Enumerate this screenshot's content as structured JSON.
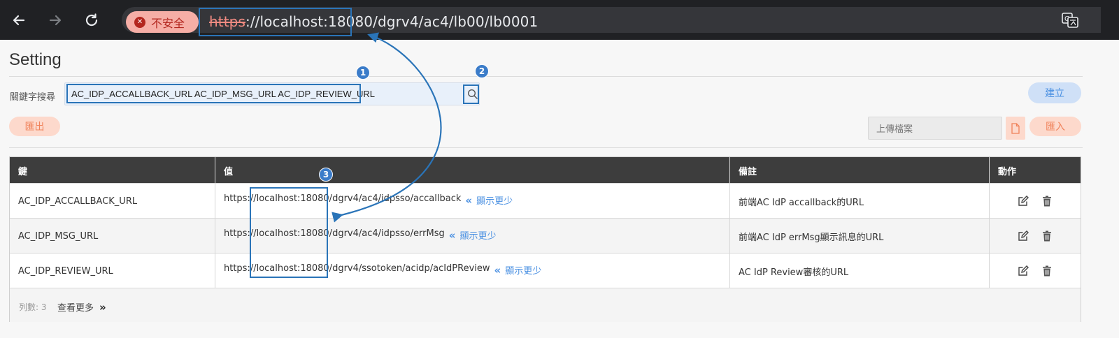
{
  "browser": {
    "insecure_label": "不安全",
    "url_protocol": "https",
    "url_rest": "://localhost:18080/dgrv4/ac4/lb00/lb0001"
  },
  "page": {
    "title": "Setting"
  },
  "search": {
    "label": "關鍵字搜尋",
    "value": "AC_IDP_ACCALLBACK_URL AC_IDP_MSG_URL AC_IDP_REVIEW_URL"
  },
  "toolbar": {
    "create_label": "建立",
    "export_label": "匯出",
    "upload_placeholder": "上傳檔案",
    "import_label": "匯入"
  },
  "table": {
    "headers": [
      "鍵",
      "值",
      "備註",
      "動作"
    ],
    "rows": [
      {
        "key": "AC_IDP_ACCALLBACK_URL",
        "value": "https://localhost:18080/dgrv4/ac4/idpsso/accallback",
        "show_less": "顯示更少",
        "note": "前端AC IdP accallback的URL"
      },
      {
        "key": "AC_IDP_MSG_URL",
        "value": "https://localhost:18080/dgrv4/ac4/idpsso/errMsg",
        "show_less": "顯示更少",
        "note": "前端AC IdP errMsg顯示訊息的URL"
      },
      {
        "key": "AC_IDP_REVIEW_URL",
        "value": "https://localhost:18080/dgrv4/ssotoken/acidp/acIdPReview",
        "show_less": "顯示更少",
        "note": "AC IdP Review審核的URL"
      }
    ],
    "footer": {
      "row_count": "列數: 3",
      "view_more": "查看更多"
    }
  },
  "annotations": {
    "b1": "1",
    "b2": "2",
    "b3": "3"
  },
  "colors": {
    "accent": "#4a90e2",
    "annotation": "#2a74b8",
    "header_bg": "#3d3d3d",
    "orange": "#f0825a"
  },
  "icons": {
    "back": "arrow-left-icon",
    "forward": "arrow-right-icon",
    "reload": "reload-icon",
    "search": "search-icon",
    "file": "file-icon",
    "edit": "edit-icon",
    "delete": "trash-icon",
    "translate": "translate-icon"
  }
}
